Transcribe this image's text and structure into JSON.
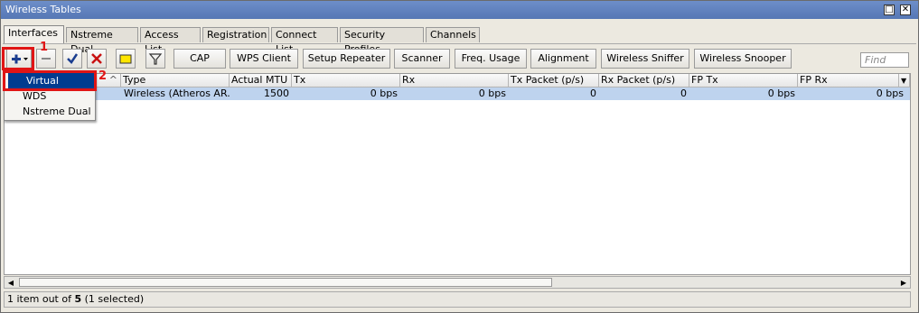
{
  "window": {
    "title": "Wireless Tables"
  },
  "tabs": [
    "Interfaces",
    "Nstreme Dual",
    "Access List",
    "Registration",
    "Connect List",
    "Security Profiles",
    "Channels"
  ],
  "toolbar": {
    "buttons": [
      "CAP",
      "WPS Client",
      "Setup Repeater",
      "Scanner",
      "Freq. Usage",
      "Alignment",
      "Wireless Sniffer",
      "Wireless Snooper"
    ],
    "find_placeholder": "Find"
  },
  "columns": [
    "Type",
    "Actual MTU",
    "Tx",
    "Rx",
    "Tx Packet (p/s)",
    "Rx Packet (p/s)",
    "FP Tx",
    "FP Rx"
  ],
  "rows": [
    {
      "type": "Wireless (Atheros AR...",
      "mtu": "1500",
      "tx": "0 bps",
      "rx": "0 bps",
      "txp": "0",
      "rxp": "0",
      "fptx": "0 bps",
      "fprx": "0 bps"
    }
  ],
  "dropdown": {
    "items": [
      "Virtual",
      "WDS",
      "Nstreme Dual"
    ],
    "selected": "Virtual"
  },
  "annotations": {
    "step1": "1",
    "step2": "2"
  },
  "status": {
    "prefix": "1 item out of ",
    "count": "5",
    "suffix": " (1 selected)"
  },
  "colors": {
    "annotation_red": "#e01515",
    "selection_blue": "#003c8f",
    "row_highlight": "#bed3ee"
  }
}
